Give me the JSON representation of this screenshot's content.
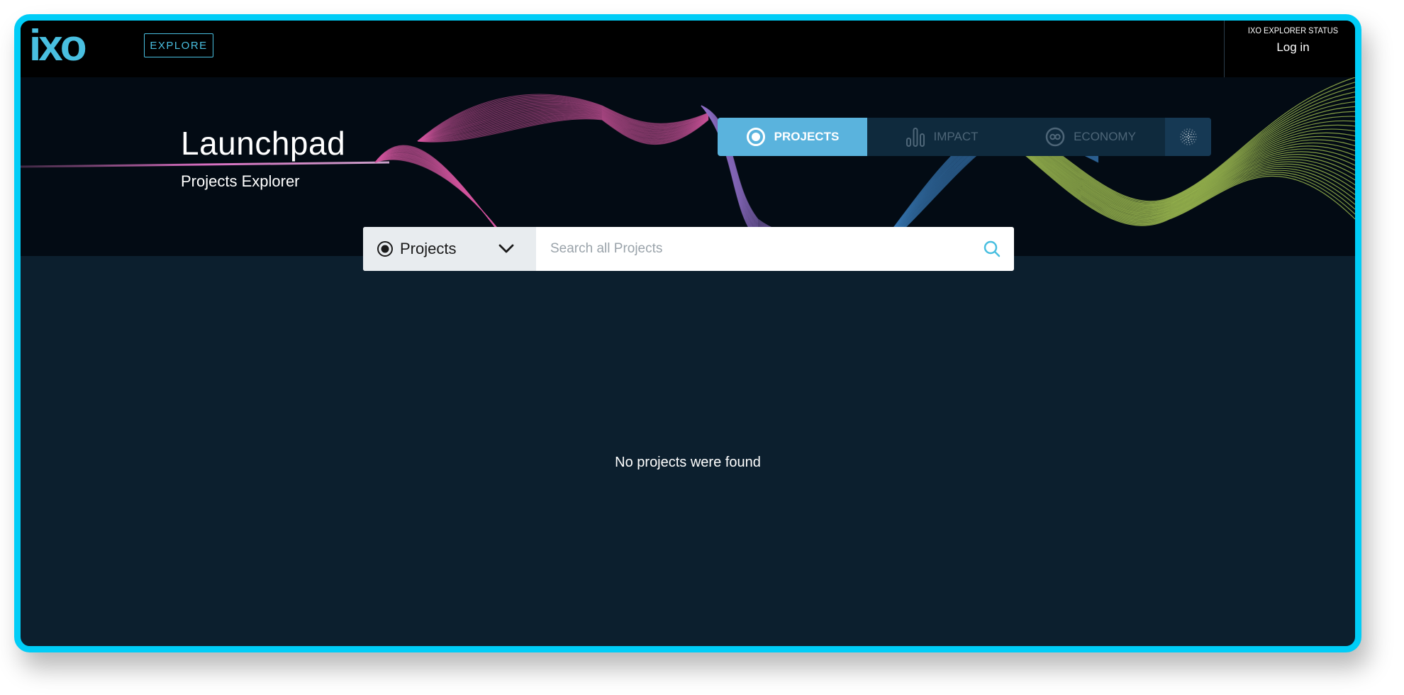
{
  "header": {
    "logo_text": "ixo",
    "explore_label": "EXPLORE",
    "status_label": "IXO EXPLORER STATUS",
    "login_label": "Log in"
  },
  "hero": {
    "title": "Launchpad",
    "subtitle": "Projects Explorer"
  },
  "tabs": [
    {
      "label": "PROJECTS",
      "icon": "projects-icon",
      "active": true
    },
    {
      "label": "IMPACT",
      "icon": "impact-icon",
      "active": false
    },
    {
      "label": "ECONOMY",
      "icon": "economy-icon",
      "active": false
    },
    {
      "label": "",
      "icon": "network-icon",
      "active": false
    }
  ],
  "search": {
    "selected_type": "Projects",
    "placeholder": "Search all Projects",
    "value": ""
  },
  "main": {
    "empty_message": "No projects were found"
  },
  "colors": {
    "frame_border": "#00cdf7",
    "accent": "#5ab3dd",
    "background": "#0c1f2e",
    "topbar": "#000000"
  }
}
